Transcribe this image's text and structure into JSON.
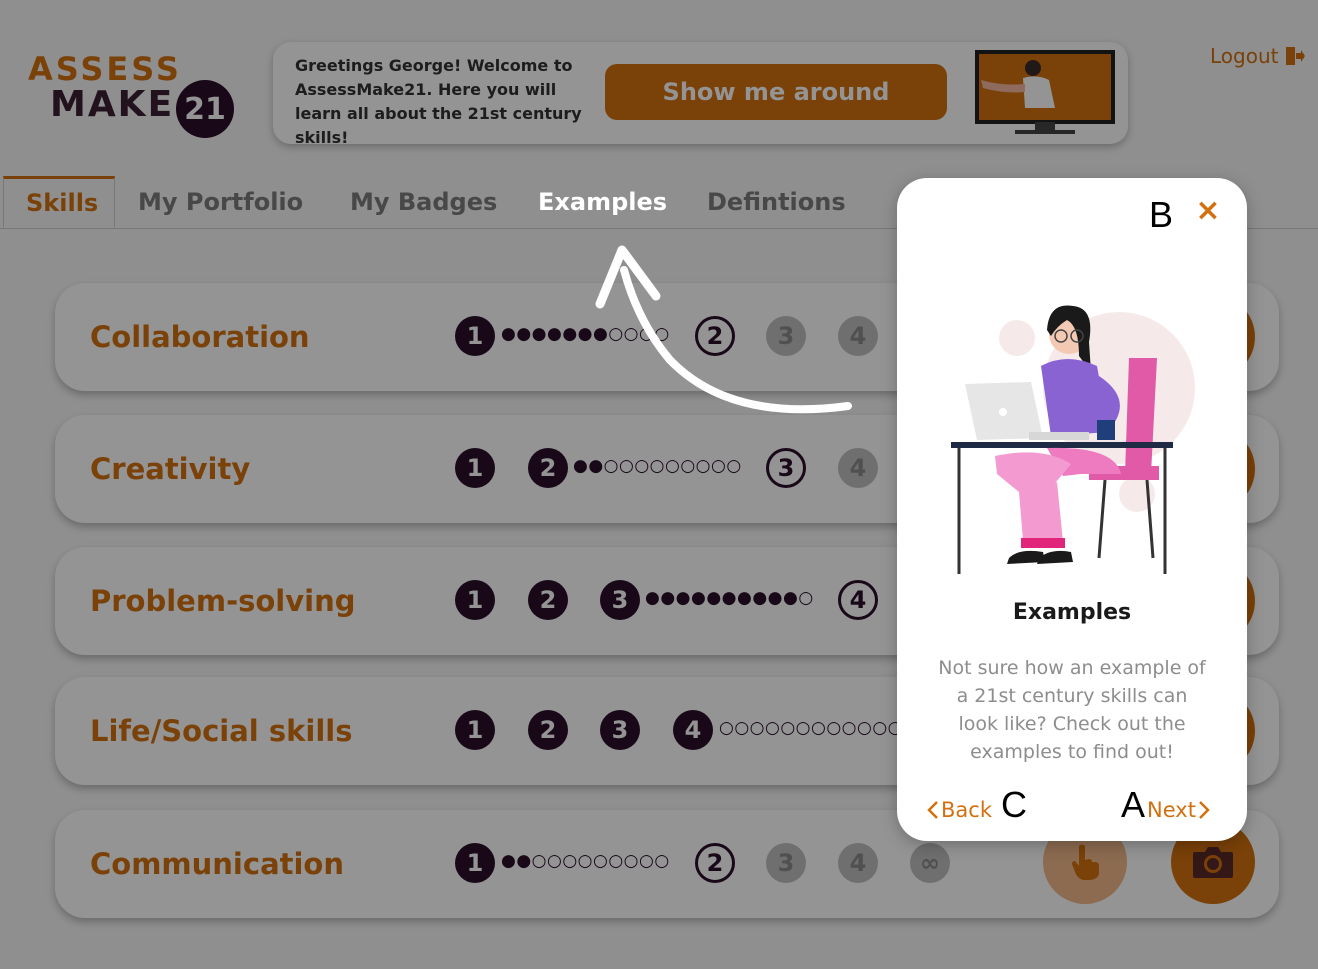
{
  "logo": {
    "line1": "ASSESS",
    "line2": "MAKE",
    "badge": "21"
  },
  "greeting": {
    "text": "Greetings George! Welcome to AssessMake21. Here you will learn all about the 21st century skills!",
    "button_label": "Show me around"
  },
  "header": {
    "logout_label": "Logout"
  },
  "tabs": [
    {
      "label": "Skills"
    },
    {
      "label": "My Portfolio"
    },
    {
      "label": "My Badges"
    },
    {
      "label": "Examples"
    },
    {
      "label": "Defintions"
    }
  ],
  "skills": [
    {
      "name": "Collaboration",
      "levels": [
        "1",
        "2",
        "3",
        "4"
      ],
      "dots": "●●●●●●●○○○○"
    },
    {
      "name": "Creativity",
      "levels": [
        "1",
        "2",
        "3",
        "4"
      ],
      "dots": "●●○○○○○○○○○"
    },
    {
      "name": "Problem-solving",
      "levels": [
        "1",
        "2",
        "3",
        "4"
      ],
      "dots": "●●●●●●●●●●○"
    },
    {
      "name": "Life/Social skills",
      "levels": [
        "1",
        "2",
        "3",
        "4"
      ],
      "dots": "○○○○○○○○○○○○"
    },
    {
      "name": "Communication",
      "levels": [
        "1",
        "2",
        "3",
        "4",
        "∞"
      ],
      "dots": "●●○○○○○○○○○"
    }
  ],
  "modal": {
    "marker_b": "B",
    "close_symbol": "×",
    "title": "Examples",
    "body": "Not sure how an example of a 21st century skills can look like? Check out the examples to find out!",
    "back_label": "Back",
    "marker_c": "C",
    "marker_a": "A",
    "next_label": "Next"
  },
  "colors": {
    "accent": "#d3700f",
    "dark": "#2a0e2a",
    "overlay": "rgba(0,0,0,0.42)"
  }
}
